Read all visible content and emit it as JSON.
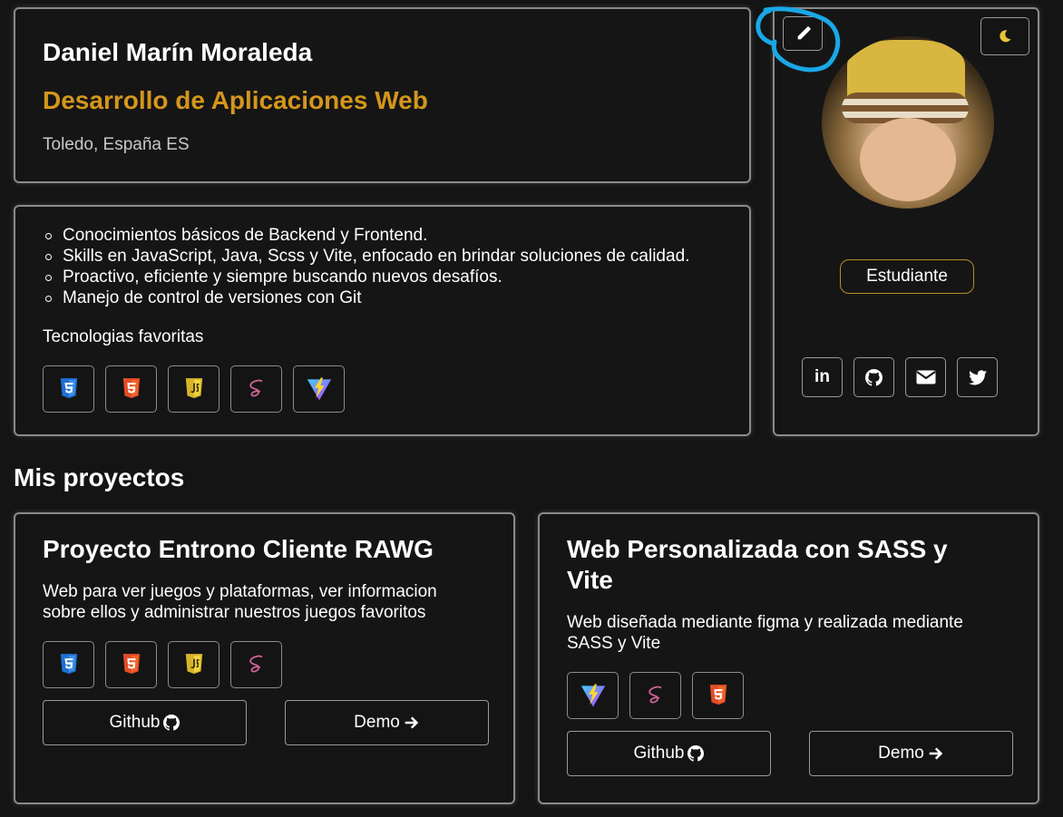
{
  "profile": {
    "name": "Daniel Marín Moraleda",
    "role": "Desarrollo de Aplicaciones Web",
    "location": "Toledo, España ES",
    "status_badge": "Estudiante"
  },
  "about": {
    "skills": [
      "Conocimientos básicos de Backend y Frontend.",
      "Skills en JavaScript, Java, Scss y Vite, enfocado en brindar soluciones de calidad.",
      "Proactivo, eficiente y siempre buscando nuevos desafíos.",
      "Manejo de control de versiones con Git"
    ],
    "tech_heading": "Tecnologias favoritas",
    "tech_icons": [
      "css3-icon",
      "html5-icon",
      "javascript-icon",
      "sass-icon",
      "vite-icon"
    ]
  },
  "sidebar": {
    "edit_icon": "pencil-icon",
    "theme_icon": "moon-icon",
    "avatar": "avatar-photo",
    "social_icons": [
      "linkedin-icon",
      "github-icon",
      "email-icon",
      "twitter-icon"
    ]
  },
  "projects_section": {
    "title": "Mis proyectos",
    "projects": [
      {
        "title": "Proyecto Entrono Cliente RAWG",
        "description": "Web para ver juegos y plataformas, ver informacion sobre ellos y administrar nuestros juegos favoritos",
        "tech_icons": [
          "css3-icon",
          "html5-icon",
          "javascript-icon",
          "sass-icon"
        ],
        "github_label": "Github",
        "demo_label": "Demo"
      },
      {
        "title": "Web Personalizada con SASS y Vite",
        "description": "Web diseñada mediante figma y realizada mediante SASS y Vite",
        "tech_icons": [
          "vite-icon",
          "sass-icon",
          "html5-icon"
        ],
        "github_label": "Github",
        "demo_label": "Demo"
      }
    ]
  },
  "colors": {
    "background": "#141414",
    "accent_gold": "#d4961c",
    "card_border": "#8a8a8a",
    "annotation_blue": "#1aa7e6"
  }
}
